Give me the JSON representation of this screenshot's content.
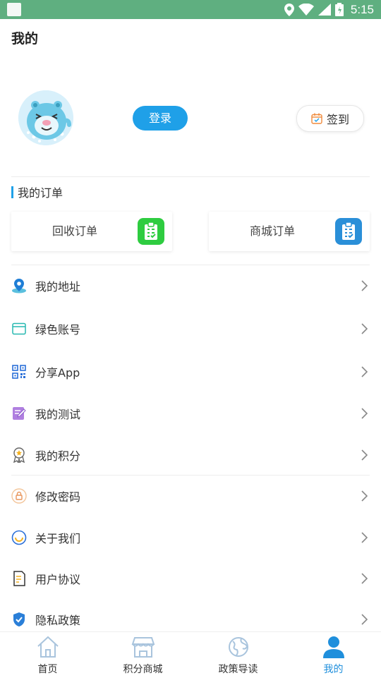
{
  "status_bar": {
    "time": "5:15"
  },
  "header": {
    "title": "我的"
  },
  "profile": {
    "login_label": "登录",
    "checkin_label": "签到"
  },
  "orders": {
    "section_title": "我的订单",
    "items": [
      {
        "label": "回收订单",
        "icon": "clipboard-icon",
        "color": "#2ecc40"
      },
      {
        "label": "商城订单",
        "icon": "clipboard-icon",
        "color": "#2a8fd8"
      }
    ]
  },
  "menu": [
    {
      "label": "我的地址",
      "icon": "location-icon"
    },
    {
      "label": "绿色账号",
      "icon": "card-icon"
    },
    {
      "label": "分享App",
      "icon": "qr-icon"
    },
    {
      "label": "我的测试",
      "icon": "edit-icon"
    },
    {
      "label": "我的积分",
      "icon": "medal-icon"
    },
    {
      "label": "修改密码",
      "icon": "lock-icon"
    },
    {
      "label": "关于我们",
      "icon": "smile-icon"
    },
    {
      "label": "用户协议",
      "icon": "document-icon"
    },
    {
      "label": "隐私政策",
      "icon": "shield-icon"
    }
  ],
  "tabbar": {
    "items": [
      {
        "label": "首页",
        "icon": "home-icon",
        "active": false
      },
      {
        "label": "积分商城",
        "icon": "store-icon",
        "active": false
      },
      {
        "label": "政策导读",
        "icon": "globe-icon",
        "active": false
      },
      {
        "label": "我的",
        "icon": "user-icon",
        "active": true
      }
    ],
    "accent": "#1f8fdc"
  }
}
